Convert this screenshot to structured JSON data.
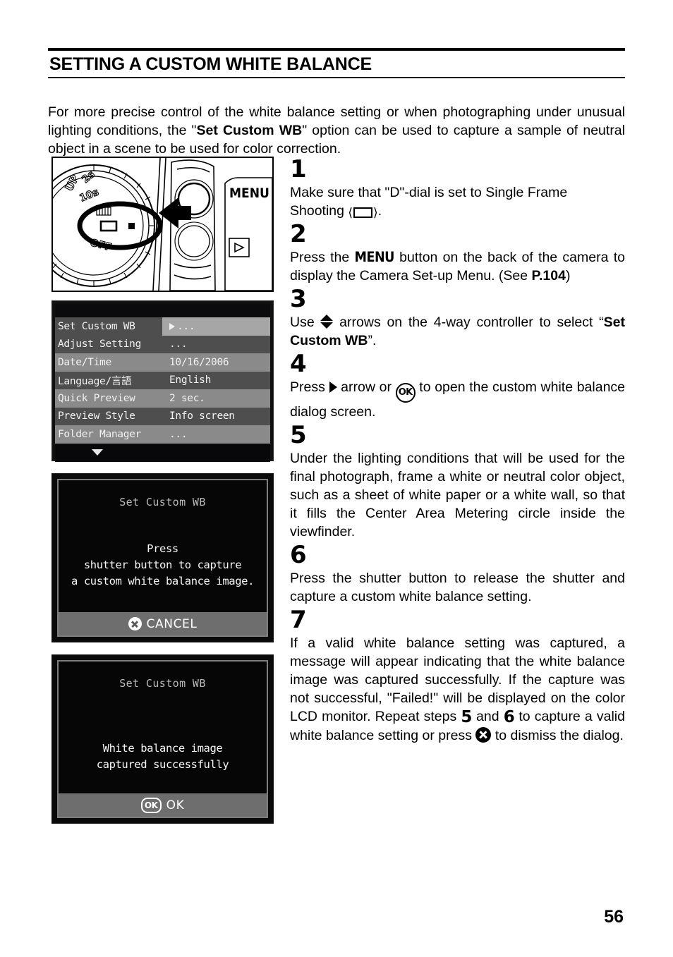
{
  "document": {
    "title": "SETTING A CUSTOM WHITE BALANCE",
    "page_number": "56",
    "intro_part1": "For more precise control of the white balance setting or when photographing under unusual lighting conditions, the \"",
    "intro_bold": "Set Custom WB",
    "intro_part2": "\" option can be used to capture a sample of neutral object in a scene to be used for color correction."
  },
  "figures": {
    "camera": {
      "menu_label": "MENU",
      "dial_marks": [
        "UP",
        "2s",
        "10s",
        "OFF"
      ],
      "caption_alt": "camera-top-dial-and-menu-button"
    },
    "menu_screen": {
      "rows": [
        {
          "label": "Set Custom WB",
          "value": "...",
          "selected": true
        },
        {
          "label": "Adjust Setting",
          "value": "...",
          "selected": false
        },
        {
          "label": "Date/Time",
          "value": "10/16/2006",
          "selected": false
        },
        {
          "label": "Language/言語",
          "value": "English",
          "selected": false
        },
        {
          "label": "Quick Preview",
          "value": "2 sec.",
          "selected": false
        },
        {
          "label": "Preview Style",
          "value": "Info screen",
          "selected": false
        },
        {
          "label": "Folder Manager",
          "value": "...",
          "selected": false
        }
      ]
    },
    "dialog_capture": {
      "title": "Set Custom WB",
      "line1": "Press",
      "line2": "shutter button to capture",
      "line3": "a custom white balance image.",
      "footer_label": "CANCEL"
    },
    "dialog_success": {
      "title": "Set Custom WB",
      "line1": "White balance image",
      "line2": "captured successfully",
      "footer_label": "OK",
      "footer_badge": "OK"
    }
  },
  "steps": [
    {
      "number": "1",
      "text_a": "Make sure that \"D\"-dial is set to Single Frame Shooting ",
      "text_b": "."
    },
    {
      "number": "2",
      "text_a": "Press the ",
      "menu": "MENU",
      "text_b": " button on the back of the camera to display the Camera Set-up Menu. (See ",
      "page_ref": "P.104",
      "text_c": ")"
    },
    {
      "number": "3",
      "text_a": "Use ",
      "text_b": " arrows on the 4-way controller to select “",
      "bold": "Set Custom WB",
      "text_c": "”."
    },
    {
      "number": "4",
      "text_a": "Press ",
      "text_b": " arrow or ",
      "ok_label": "OK",
      "text_c": " to open the custom white balance dialog screen."
    },
    {
      "number": "5",
      "text_a": "Under the lighting conditions that will be used for the final photograph, frame a white or neutral color object, such as a sheet of white paper or a white wall, so that it fills the Center Area Metering circle inside the viewfinder."
    },
    {
      "number": "6",
      "text_a": "Press the shutter button to release the shutter and capture a custom white balance setting."
    },
    {
      "number": "7",
      "text_a": "If a valid white balance setting was captured, a message will appear indicating that the white balance image was captured successfully. If the capture was not successful, \"Failed!\" will be displayed on the color LCD monitor. Repeat steps ",
      "ref_step_1": "5",
      "text_b": " and ",
      "ref_step_2": "6",
      "text_c": " to capture a valid white balance setting or press ",
      "text_d": " to dismiss the dialog."
    }
  ]
}
